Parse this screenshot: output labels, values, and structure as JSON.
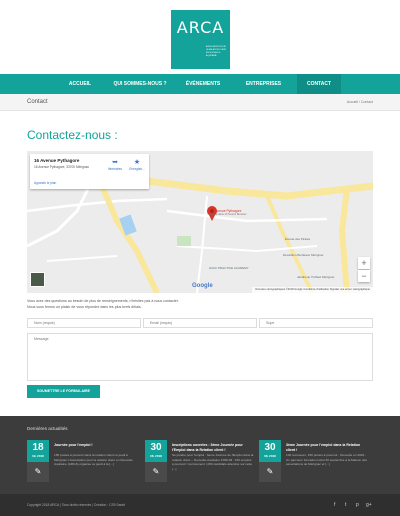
{
  "logo": {
    "brand": "ARCA",
    "tagline": "ASSOCIATION POUR LA RELATION CLIENT EN NOUVELLE-AQUITAINE"
  },
  "nav": {
    "items": [
      {
        "label": "ACCUEIL"
      },
      {
        "label": "QUI SOMMES-NOUS ?"
      },
      {
        "label": "ÉVÉNEMENTS"
      },
      {
        "label": "ENTREPRISES"
      },
      {
        "label": "CONTACT"
      }
    ]
  },
  "page": {
    "title": "Contact",
    "breadcrumb": "Accueil / Contact",
    "heading": "Contactez-nous :"
  },
  "map": {
    "place_name": "16 Avenue Pythagore",
    "address": "16 Avenue Pythagore, 33700 Mérignac",
    "larger_map": "Agrandir le plan",
    "action_directions": "Itinéraires",
    "action_save": "Enregistr...",
    "pin_label": "16 Avenue Pythagore",
    "pin_sublabel": "Ferme dans 10 heures Bureaux",
    "labels": {
      "poi1": "Écoute des Pirates",
      "poi2": "Décathlon Bordeaux Mérignac",
      "poi3": "GOLF PRACTICE ACADEMY",
      "poi4": "Jardinerie Truffaut Mérignac"
    },
    "zoom_in": "+",
    "zoom_out": "−",
    "google": "Google",
    "footer_text": "Données cartographiques ©2018 Google    Conditions d'utilisation    Signaler une erreur cartographique",
    "colors": {
      "road_major": "#f9e79b",
      "road_minor": "#ffffff",
      "land": "#ececec",
      "water": "#a8d0f0",
      "pin": "#d9352a"
    }
  },
  "form": {
    "intro_line1": "Vous avez des questions au besoin de plus de renseignements, n'hésitez pas à nous contacter.",
    "intro_line2": "Nous vous ferons un plaisir de vous répondre dans les plus brefs délais.",
    "name_placeholder": "Nom (requis)",
    "email_placeholder": "Email (requis)",
    "subject_placeholder": "Sujet",
    "message_placeholder": "Message",
    "submit_label": "SOUMETTRE LE FORMULAIRE"
  },
  "footer": {
    "section_title": "Dernières actualités",
    "news": [
      {
        "day": "18",
        "month_year": "09, 2018",
        "title": "Journée pour l'emploi !",
        "excerpt": "150 postes à pourvoir dans la relation client ce jeudi à Mérignac L'Association pour la relation client en Nouvelle-Aquitaine (ARCA) organise ce jeudi à la [...]"
      },
      {
        "day": "30",
        "month_year": "08, 2018",
        "title": "Inscriptions ouvertes : 3ème Journée pour l'Emploi dans la Relation client !",
        "excerpt": "Se joindre pour l'emploi : 3ème Journée de l'Emploi dans la relation client -- Nouvelle-Aquitaine FORUM : 150 emplois à pourvoir ! recrutement | 200 candidats attendus sur cette [...]"
      },
      {
        "day": "30",
        "month_year": "08, 2018",
        "title": "3ème Journée pour l'emploi dans la Relation client !",
        "excerpt": "100 recruteurs, 150 postes à pourvoir - Nouvelle en 2018 - Un parcours formation inclut 30 septembre à la Maison des associations de Mérignac et [...]"
      }
    ],
    "copyright": "Copyright 2018 ARCA | Tous droits réservés | Création : CS9 Santé",
    "social": [
      "f",
      "t",
      "p",
      "g+"
    ]
  }
}
